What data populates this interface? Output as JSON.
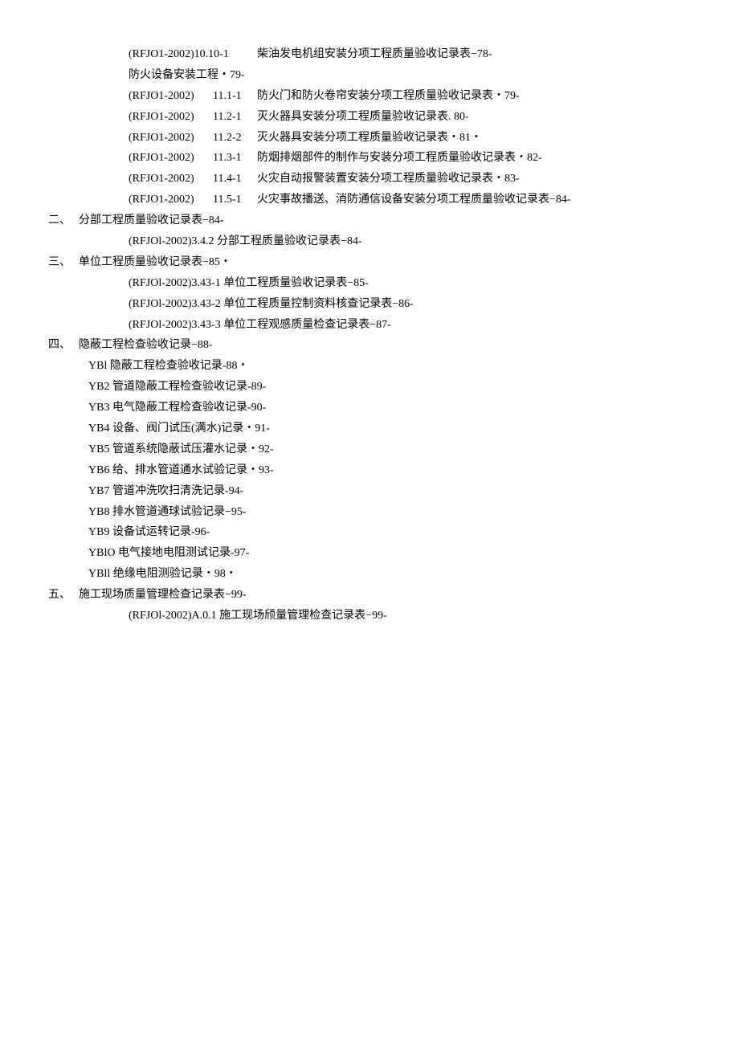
{
  "topCodeLines": [
    {
      "code": "(RFJO1-2002)10.10-1",
      "num": "",
      "desc": "柴油发电机组安装分项工程质量验收记录表−78-",
      "merged": true
    }
  ],
  "topPlain": "防火设备安装工程・79-",
  "codeLines": [
    {
      "code": "(RFJO1-2002)",
      "num": "11.1-1",
      "desc": "防火门和防火卷帘安装分项工程质量验收记录表・79-"
    },
    {
      "code": "(RFJO1-2002)",
      "num": "11.2-1",
      "desc": "灭火器具安装分项工程质量验收记录表. 80-"
    },
    {
      "code": "(RFJO1-2002)",
      "num": "11.2-2",
      "desc": "灭火器具安装分项工程质量验收记录表・81・"
    },
    {
      "code": "(RFJO1-2002)",
      "num": "11.3-1",
      "desc": "防烟排烟部件的制作与安装分项工程质量验收记录表・82-"
    },
    {
      "code": "(RFJO1-2002)",
      "num": "11.4-1",
      "desc": "火灾自动报警装置安装分项工程质量验收记录表・83-"
    },
    {
      "code": "(RFJO1-2002)",
      "num": "11.5-1",
      "desc": "火灾事故播送、消防通信设备安装分项工程质量验收记录表−84-"
    }
  ],
  "section2": {
    "num": "二、",
    "title": "分部工程质量验收记录表−84-",
    "items": [
      "(RFJOl-2002)3.4.2 分部工程质量验收记录表−84-"
    ]
  },
  "section3": {
    "num": "三、",
    "title": "单位工程质量验收记录表−85・",
    "items": [
      "(RFJOl-2002)3.43-1 单位工程质量验收记录表−85-",
      "(RFJOl-2002)3.43-2 单位工程质量控制资料核查记录表−86-",
      "(RFJOl-2002)3.43-3 单位工程观感质量检查记录表−87-"
    ]
  },
  "section4": {
    "num": "四、",
    "title": "隐蔽工程检查验收记录−88-",
    "items": [
      "YBl 隐蔽工程检查验收记录-88・",
      "YB2 管道隐蔽工程检查验收记录-89-",
      "YB3 电气隐蔽工程检查验收记录-90-",
      "YB4 设备、阀门试压(满水)记录・91-",
      "YB5 管道系统隐蔽试压灌水记录・92-",
      "YB6 给、排水管道通水试验记录・93-",
      "YB7 管道冲洗吹扫清洗记录-94-",
      "YB8 排水管道通球试验记录−95-",
      "YB9 设备试运转记录-96-",
      "YBlO 电气接地电阻测试记录-97-",
      "YBll 绝缘电阻测验记录・98・"
    ]
  },
  "section5": {
    "num": "五、",
    "title": "施工现场质量管理检查记录表−99-",
    "items": [
      "(RFJOl-2002)A.0.1 施工现场颀量管理检查记录表−99-"
    ]
  }
}
